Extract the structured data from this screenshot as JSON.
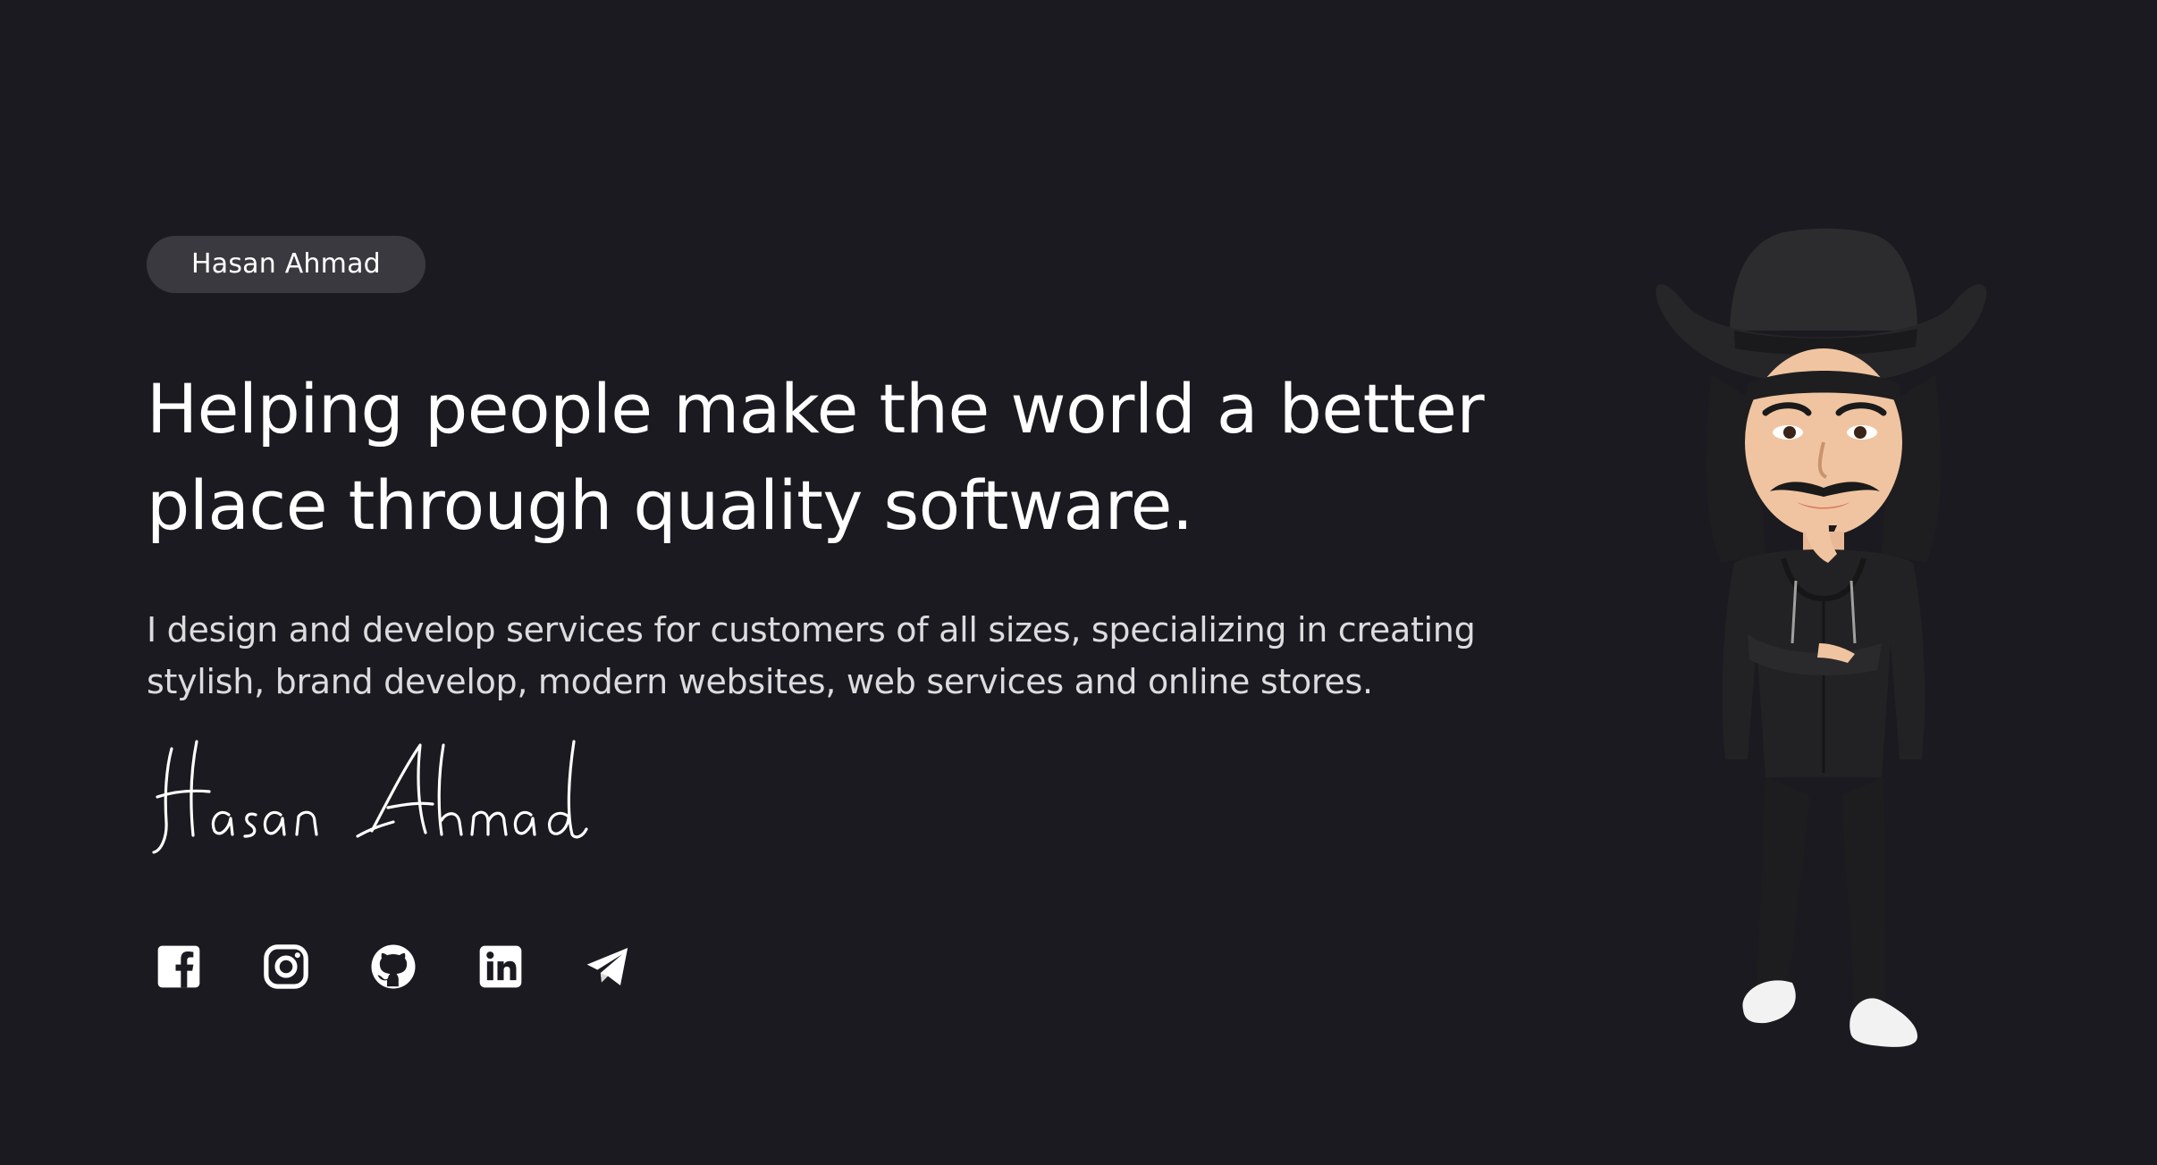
{
  "hero": {
    "badge_label": "Hasan Ahmad",
    "headline_line1": "Helping people make the world a better",
    "headline_line2": "place through quality software.",
    "subtitle_line1": "I design and develop services for customers of all sizes, specializing in creating",
    "subtitle_line2": "stylish, brand develop, modern websites, web services and online stores.",
    "signature_text": "Hasan Ahmad"
  },
  "social": [
    {
      "icon": "facebook-icon"
    },
    {
      "icon": "instagram-icon"
    },
    {
      "icon": "github-icon"
    },
    {
      "icon": "linkedin-icon"
    },
    {
      "icon": "telegram-icon"
    }
  ],
  "colors": {
    "background": "#1b1a20",
    "badge_bg": "#3a393f",
    "text": "#ffffff",
    "subtitle": "#dcdcde"
  }
}
